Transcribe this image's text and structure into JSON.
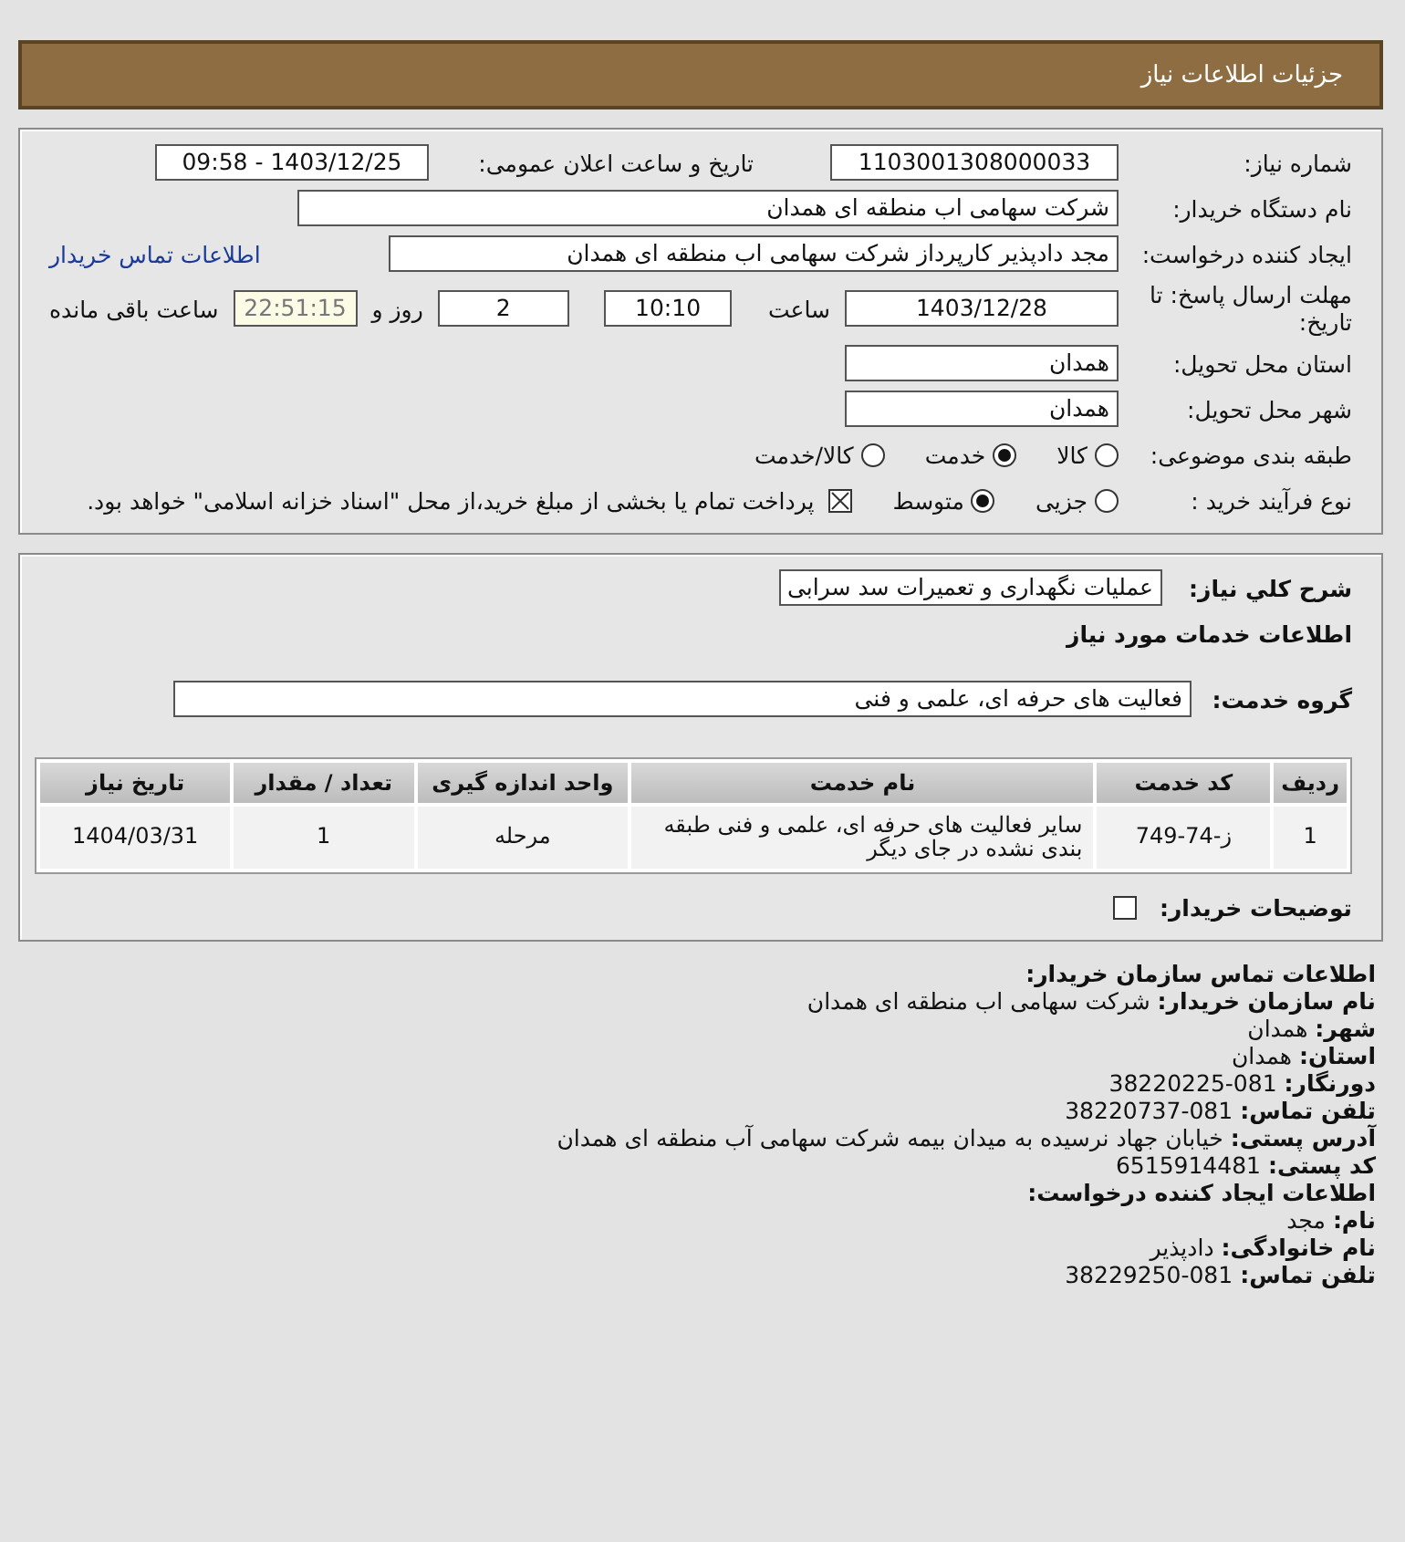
{
  "header": {
    "title": "جزئیات اطلاعات نیاز"
  },
  "details": {
    "need_number": {
      "label": "شماره نیاز:",
      "value": "1103001308000033"
    },
    "announce": {
      "label": "تاریخ و ساعت اعلان عمومی:",
      "value": "1403/12/25 - 09:58"
    },
    "buyer": {
      "label": "نام دستگاه خریدار:",
      "value": "شرکت سهامی اب منطقه ای همدان"
    },
    "requester": {
      "label": "ایجاد کننده درخواست:",
      "value": "مجد دادپذیر کارپرداز شرکت سهامی اب منطقه ای همدان",
      "link": "اطلاعات تماس خریدار"
    },
    "deadline": {
      "label": "مهلت ارسال پاسخ: تا تاریخ:",
      "date": "1403/12/28",
      "time_label": "ساعت",
      "time": "10:10",
      "days": "2",
      "days_label": "روز و",
      "remaining": "22:51:15",
      "remaining_label": "ساعت باقی مانده"
    },
    "province": {
      "label": "استان محل تحویل:",
      "value": "همدان"
    },
    "city": {
      "label": "شهر محل تحویل:",
      "value": "همدان"
    },
    "category": {
      "label": "طبقه بندی موضوعی:",
      "options": [
        {
          "label": "کالا",
          "selected": false
        },
        {
          "label": "خدمت",
          "selected": true
        },
        {
          "label": "کالا/خدمت",
          "selected": false
        }
      ]
    },
    "process": {
      "label": "نوع فرآیند خرید :",
      "options": [
        {
          "label": "جزیی",
          "selected": false
        },
        {
          "label": "متوسط",
          "selected": true
        }
      ],
      "treasury": {
        "checked": true,
        "text": "پرداخت تمام یا بخشی از مبلغ خرید،از محل \"اسناد خزانه اسلامی\" خواهد بود."
      }
    }
  },
  "services": {
    "summary": {
      "label": "شرح كلي نیاز:",
      "value": "عملیات نگهداری و تعمیرات سد سرابی"
    },
    "title": "اطلاعات خدمات مورد نیاز",
    "group": {
      "label": "گروه خدمت:",
      "value": "فعالیت های حرفه ای، علمی و فنی"
    },
    "table": {
      "columns": [
        "ردیف",
        "کد خدمت",
        "نام خدمت",
        "واحد اندازه گیری",
        "تعداد / مقدار",
        "تاریخ نیاز"
      ],
      "rows": [
        [
          "1",
          "ز-74-749",
          "سایر فعالیت های حرفه ای، علمی و فنی طبقه بندی نشده در جای دیگر",
          "مرحله",
          "1",
          "1404/03/31"
        ]
      ]
    },
    "buyer_notes": {
      "label": "توضیحات خریدار:",
      "checked": false
    }
  },
  "contact": [
    {
      "kind": "heading",
      "text": "اطلاعات تماس سازمان خریدار:"
    },
    {
      "kind": "field",
      "text": "**نام سازمان خریدار:** شرکت سهامی اب منطقه ای همدان"
    },
    {
      "kind": "field",
      "text": "**شهر:** همدان"
    },
    {
      "kind": "field",
      "text": "**استان:** همدان"
    },
    {
      "kind": "field",
      "text": "**دورنگار:** 081-38220225"
    },
    {
      "kind": "field",
      "text": "**تلفن تماس:** 081-38220737"
    },
    {
      "kind": "field",
      "text": "**آدرس پستی:** خیابان جهاد نرسیده به میدان بیمه شرکت سهامی آب منطقه ای همدان"
    },
    {
      "kind": "field",
      "text": "**کد پستی:** 6515914481"
    },
    {
      "kind": "heading",
      "text": "اطلاعات ایجاد کننده درخواست:"
    },
    {
      "kind": "field",
      "text": "**نام:** مجد"
    },
    {
      "kind": "field",
      "text": "**نام خانوادگی:** دادپذیر"
    },
    {
      "kind": "field",
      "text": "**تلفن تماس:** 081-38229250"
    }
  ]
}
